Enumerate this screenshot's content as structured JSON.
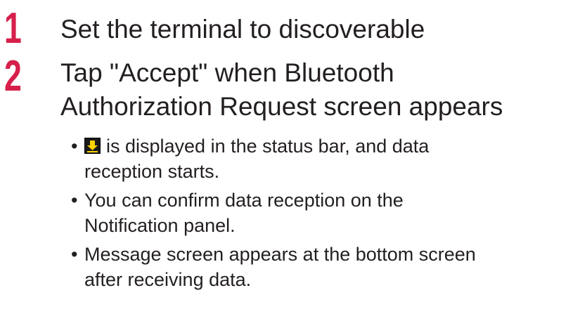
{
  "steps": [
    {
      "number": "1",
      "text": "Set the terminal to discoverable"
    },
    {
      "number": "2",
      "line1": "Tap \"Accept\" when Bluetooth",
      "line2": "Authorization Request screen appears"
    }
  ],
  "bullets": [
    {
      "icon": "download-icon",
      "line1": "is displayed in the status bar, and data",
      "line2": "reception starts."
    },
    {
      "line1": "You can confirm data reception on the",
      "line2": "Notification panel."
    },
    {
      "line1": "Message screen appears at the bottom screen",
      "line2": "after receiving data."
    }
  ],
  "bullet_char": "•",
  "colors": {
    "step_number": "#d6204b",
    "text": "#231f20",
    "icon_bg": "#1a1a1a",
    "icon_arrow": "#ffd400"
  }
}
